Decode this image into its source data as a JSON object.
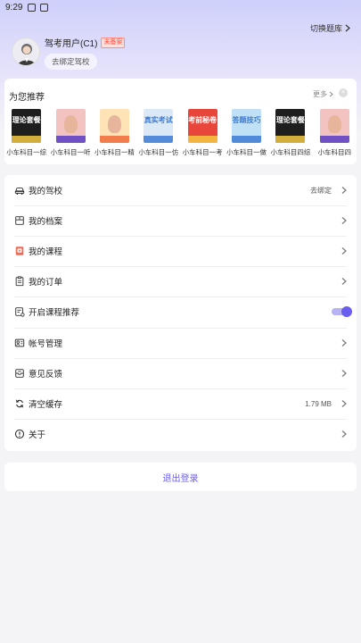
{
  "status_bar": {
    "time": "9:29"
  },
  "header": {
    "switch_label": "切换题库",
    "username": "驾考用户(C1)",
    "badge": "未备案",
    "bind_school": "去绑定驾校"
  },
  "recommend": {
    "title": "为您推荐",
    "more": "更多",
    "items": [
      {
        "label": "小车科目一综",
        "cover_text": "理论套餐",
        "cover_color": "#1e1e1e",
        "accent": "#f5c842"
      },
      {
        "label": "小车科目一听",
        "cover_text": "",
        "cover_color": "#f2c3c0",
        "accent": "#5b3cc4"
      },
      {
        "label": "小车科目一精",
        "cover_text": "",
        "cover_color": "#fde3b5",
        "accent": "#ef6a3a"
      },
      {
        "label": "小车科目一仿",
        "cover_text": "真实考试",
        "cover_color": "#dbe9f7",
        "accent": "#3c7bd4"
      },
      {
        "label": "小车科目一考",
        "cover_text": "考前秘卷",
        "cover_color": "#e9463b",
        "accent": "#f5c842"
      },
      {
        "label": "小车科目一做",
        "cover_text": "答题技巧",
        "cover_color": "#bfe0f5",
        "accent": "#3c7bd4"
      },
      {
        "label": "小车科目四综",
        "cover_text": "理论套餐",
        "cover_color": "#1e1e1e",
        "accent": "#f5c842"
      },
      {
        "label": "小车科目四",
        "cover_text": "",
        "cover_color": "#f2c3c0",
        "accent": "#5b3cc4"
      }
    ]
  },
  "menu": [
    {
      "label": "我的驾校",
      "value": "去绑定",
      "icon": "car-icon"
    },
    {
      "label": "我的档案",
      "value": "",
      "icon": "archive-icon"
    },
    {
      "label": "我的课程",
      "value": "",
      "icon": "course-icon"
    },
    {
      "label": "我的订单",
      "value": "",
      "icon": "order-icon"
    },
    {
      "label": "开启课程推荐",
      "value": "",
      "icon": "recommend-icon",
      "toggle": true
    },
    {
      "label": "帐号管理",
      "value": "",
      "icon": "account-icon"
    },
    {
      "label": "意见反馈",
      "value": "",
      "icon": "feedback-icon"
    },
    {
      "label": "清空缓存",
      "value": "1.79 MB",
      "icon": "refresh-icon"
    },
    {
      "label": "关于",
      "value": "",
      "icon": "info-icon"
    }
  ],
  "logout_label": "退出登录",
  "colors": {
    "accent": "#6a5ef0",
    "badge": "#ff4b3e"
  }
}
